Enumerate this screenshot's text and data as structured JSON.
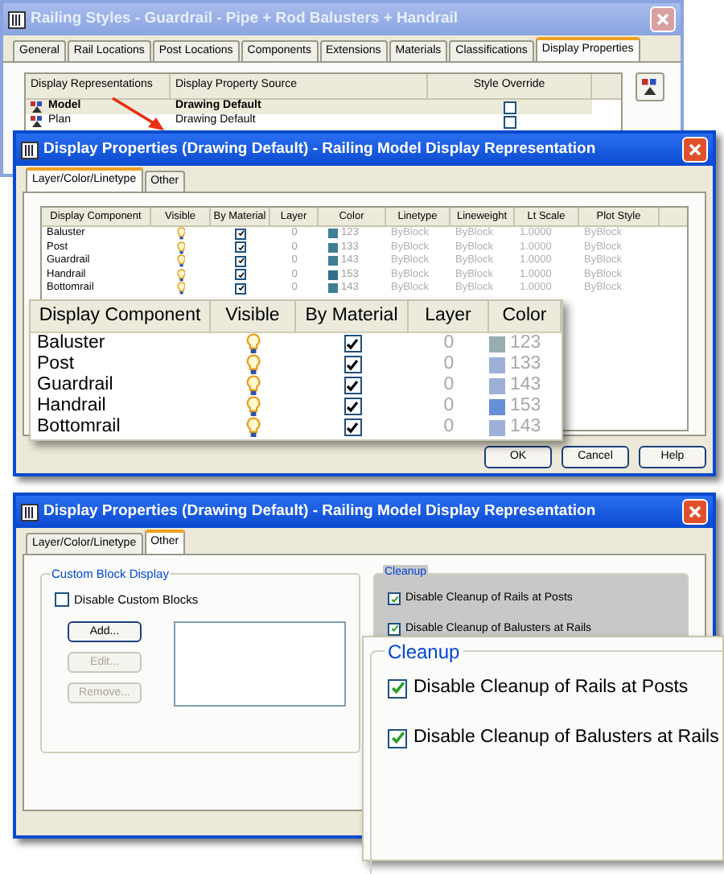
{
  "styles_window": {
    "title": "Railing Styles - Guardrail - Pipe + Rod Balusters + Handrail",
    "active": false,
    "tabs": [
      {
        "label": "General",
        "selected": false
      },
      {
        "label": "Rail Locations",
        "selected": false
      },
      {
        "label": "Post Locations",
        "selected": false
      },
      {
        "label": "Components",
        "selected": false
      },
      {
        "label": "Extensions",
        "selected": false
      },
      {
        "label": "Materials",
        "selected": false
      },
      {
        "label": "Classifications",
        "selected": false
      },
      {
        "label": "Display Properties",
        "selected": true
      }
    ],
    "columns": [
      "Display Representations",
      "Display Property Source",
      "Style Override"
    ],
    "rows": [
      {
        "name": "Model",
        "source": "Drawing Default",
        "override": false,
        "selected": true
      },
      {
        "name": "Plan",
        "source": "Drawing Default",
        "override": false,
        "selected": false
      }
    ]
  },
  "display_window": {
    "title": "Display Properties (Drawing Default) - Railing Model Display Representation",
    "active": true,
    "tabs": [
      {
        "label": "Layer/Color/Linetype",
        "selected": true
      },
      {
        "label": "Other",
        "selected": false
      }
    ],
    "columns": [
      "Display Component",
      "Visible",
      "By Material",
      "Layer",
      "Color",
      "Linetype",
      "Lineweight",
      "Lt Scale",
      "Plot Style"
    ],
    "rows": [
      {
        "component": "Baluster",
        "visible": true,
        "by_material": true,
        "layer": "0",
        "color": "#3f7f94",
        "color_number": "123",
        "linetype": "ByBlock",
        "lineweight": "ByBlock",
        "lt_scale": "1.0000",
        "plot_style": "ByBlock"
      },
      {
        "component": "Post",
        "visible": true,
        "by_material": true,
        "layer": "0",
        "color": "#3f7f94",
        "color_number": "133",
        "linetype": "ByBlock",
        "lineweight": "ByBlock",
        "lt_scale": "1.0000",
        "plot_style": "ByBlock"
      },
      {
        "component": "Guardrail",
        "visible": true,
        "by_material": true,
        "layer": "0",
        "color": "#3f7f94",
        "color_number": "143",
        "linetype": "ByBlock",
        "lineweight": "ByBlock",
        "lt_scale": "1.0000",
        "plot_style": "ByBlock"
      },
      {
        "component": "Handrail",
        "visible": true,
        "by_material": true,
        "layer": "0",
        "color": "#2f6f8c",
        "color_number": "153",
        "linetype": "ByBlock",
        "lineweight": "ByBlock",
        "lt_scale": "1.0000",
        "plot_style": "ByBlock"
      },
      {
        "component": "Bottomrail",
        "visible": true,
        "by_material": true,
        "layer": "0",
        "color": "#3f7f94",
        "color_number": "143",
        "linetype": "ByBlock",
        "lineweight": "ByBlock",
        "lt_scale": "1.0000",
        "plot_style": "ByBlock"
      }
    ],
    "buttons": [
      "OK",
      "Cancel",
      "Help"
    ]
  },
  "table_callout": {
    "columns": [
      "Display Component",
      "Visible",
      "By Material",
      "Layer",
      "Color"
    ],
    "rows": [
      {
        "component": "Baluster",
        "visible": true,
        "by_material": true,
        "layer": "0",
        "color": "#95aeb0",
        "color_number": "123"
      },
      {
        "component": "Post",
        "visible": true,
        "by_material": true,
        "layer": "0",
        "color": "#9db0d8",
        "color_number": "133"
      },
      {
        "component": "Guardrail",
        "visible": true,
        "by_material": true,
        "layer": "0",
        "color": "#9db0d8",
        "color_number": "143"
      },
      {
        "component": "Handrail",
        "visible": true,
        "by_material": true,
        "layer": "0",
        "color": "#6690d8",
        "color_number": "153"
      },
      {
        "component": "Bottomrail",
        "visible": true,
        "by_material": true,
        "layer": "0",
        "color": "#9db0d8",
        "color_number": "143"
      }
    ]
  },
  "other_window": {
    "title": "Display Properties (Drawing Default) - Railing Model Display Representation",
    "active": true,
    "tabs": [
      {
        "label": "Layer/Color/Linetype",
        "selected": false
      },
      {
        "label": "Other",
        "selected": true
      }
    ],
    "custom_block": {
      "title": "Custom Block Display",
      "checkbox": {
        "label": "Disable Custom Blocks",
        "checked": false
      },
      "buttons": [
        {
          "label": "Add...",
          "disabled": false
        },
        {
          "label": "Edit...",
          "disabled": true
        },
        {
          "label": "Remove...",
          "disabled": true
        }
      ]
    },
    "cleanup": {
      "title": "Cleanup",
      "options": [
        {
          "label": "Disable Cleanup of Rails at Posts",
          "checked": true
        },
        {
          "label": "Disable Cleanup of Balusters at Rails",
          "checked": true
        }
      ]
    }
  },
  "cleanup_callout": {
    "title": "Cleanup",
    "options": [
      {
        "label": "Disable Cleanup of Rails at Posts",
        "checked": true
      },
      {
        "label": "Disable Cleanup of Balusters at Rails",
        "checked": true
      }
    ]
  }
}
